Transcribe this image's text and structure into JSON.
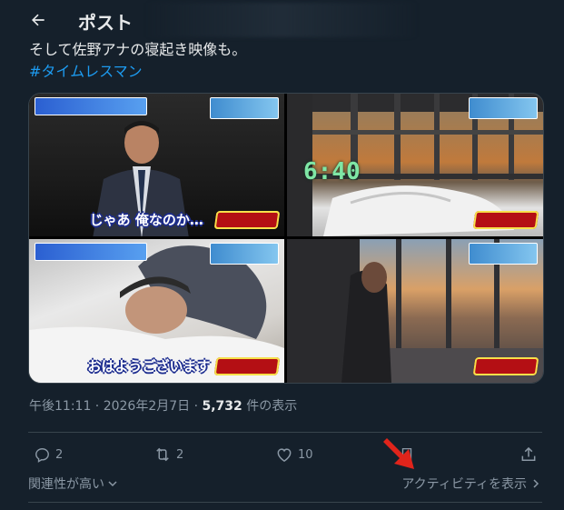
{
  "header": {
    "title": "ポスト",
    "back_icon": "arrow-left-icon"
  },
  "tweet": {
    "text_line1": "そして佐野アナの寝起き映像も。",
    "hashtag": "#タイムレスマン"
  },
  "media": {
    "captions": [
      "じゃあ 俺なのか…",
      "",
      "おはようございます",
      ""
    ],
    "clock_text": "6:40"
  },
  "meta": {
    "timestamp": "午後11:11 · 2026年2月7日 · ",
    "views_count": "5,732",
    "views_suffix": " 件の表示"
  },
  "actions": {
    "reply_count": "2",
    "repost_count": "2",
    "like_count": "10"
  },
  "footer": {
    "sort_label": "関連性が高い",
    "activity_label": "アクティビティを表示"
  },
  "colors": {
    "background": "#15202b",
    "text_primary": "#e7e9ea",
    "text_secondary": "#8b98a5",
    "accent": "#1d9bf0",
    "annotation_arrow": "#e0241b"
  }
}
